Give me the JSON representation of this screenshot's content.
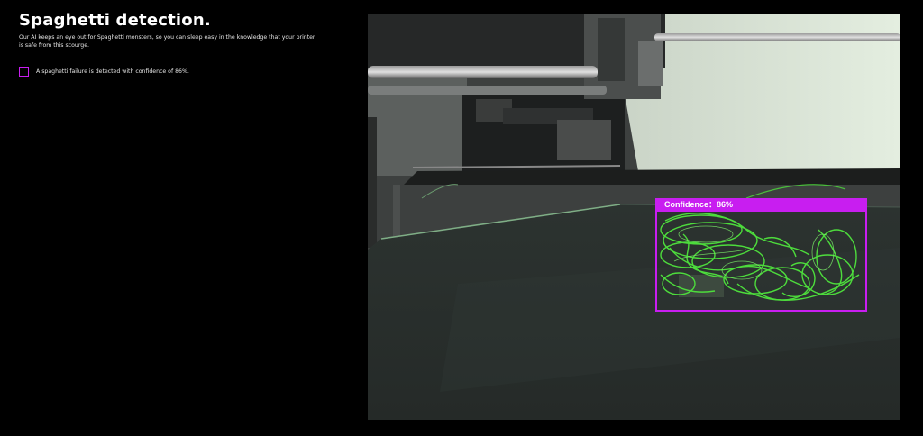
{
  "header": {
    "title": "Spaghetti detection.",
    "description": "Our AI keeps an eye out for Spaghetti monsters, so you can sleep easy in the knowledge that your printer is safe from this scourge."
  },
  "legend": {
    "text": "A spaghetti failure is detected with confidence of 86%."
  },
  "camera": {
    "detection_label": "Confidence：86%",
    "confidence": 0.86
  },
  "colors": {
    "background": "#000000",
    "detection_box": "#c81ef0",
    "spaghetti": "#4ddc3c"
  },
  "icons": {
    "legend": "square-outline-icon"
  }
}
